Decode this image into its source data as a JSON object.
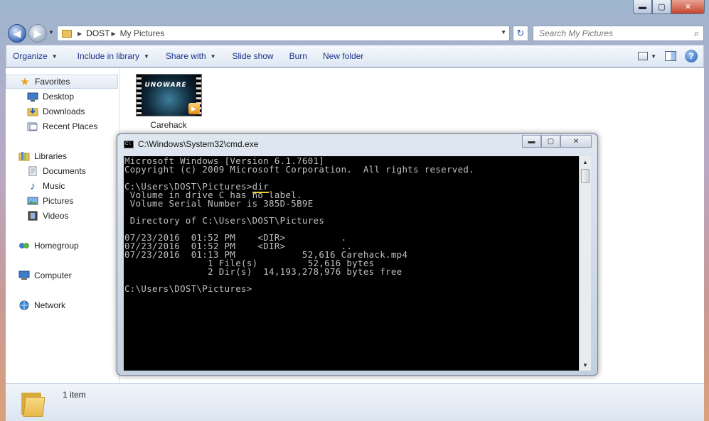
{
  "window": {
    "controls": {
      "minimize": "▬",
      "maximize": "▢",
      "close": "✕"
    }
  },
  "address": {
    "crumbs": [
      "DOST",
      "My Pictures"
    ],
    "search_placeholder": "Search My Pictures"
  },
  "toolbar": {
    "organize": "Organize",
    "include_in_library": "Include in library",
    "share_with": "Share with",
    "slide_show": "Slide show",
    "burn": "Burn",
    "new_folder": "New folder"
  },
  "sidebar": {
    "favorites": {
      "label": "Favorites",
      "items": [
        "Desktop",
        "Downloads",
        "Recent Places"
      ]
    },
    "libraries": {
      "label": "Libraries",
      "items": [
        "Documents",
        "Music",
        "Pictures",
        "Videos"
      ]
    },
    "homegroup": "Homegroup",
    "computer": "Computer",
    "network": "Network"
  },
  "files": [
    {
      "name": "Carehack",
      "thumb_text": "UNOWARE"
    }
  ],
  "status": {
    "count": "1 item"
  },
  "cmd": {
    "title": "C:\\Windows\\System32\\cmd.exe",
    "lines": {
      "l1": "Microsoft Windows [Version 6.1.7601]",
      "l2": "Copyright (c) 2009 Microsoft Corporation.  All rights reserved.",
      "prompt1": "C:\\Users\\DOST\\Pictures>",
      "command": "dir",
      "l4": " Volume in drive C has no label.",
      "l5": " Volume Serial Number is 385D-5B9E",
      "l6": " Directory of C:\\Users\\DOST\\Pictures",
      "l7": "07/23/2016  01:52 PM    <DIR>          .",
      "l8": "07/23/2016  01:52 PM    <DIR>          ..",
      "l9": "07/23/2016  01:13 PM            52,616 Carehack.mp4",
      "l10": "               1 File(s)         52,616 bytes",
      "l11": "               2 Dir(s)  14,193,278,976 bytes free",
      "prompt2": "C:\\Users\\DOST\\Pictures>"
    }
  },
  "colors": {
    "accent": "#1e3287",
    "highlight_underline": "#f2d230",
    "console_bg": "#000000",
    "console_fg": "#c0c0c0"
  }
}
